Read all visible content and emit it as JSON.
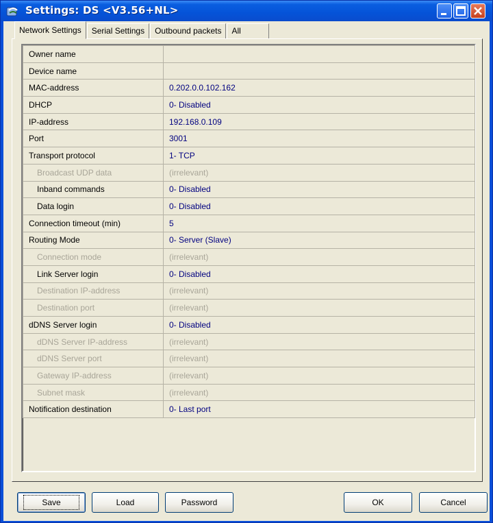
{
  "window": {
    "title": "Settings: DS <V3.56+NL>"
  },
  "tabs": [
    {
      "label": "Network Settings",
      "active": true
    },
    {
      "label": "Serial Settings",
      "active": false
    },
    {
      "label": "Outbound packets",
      "active": false
    },
    {
      "label": "All",
      "active": false
    }
  ],
  "settings": [
    {
      "name": "Owner name",
      "value": "",
      "indent": false,
      "muted": false
    },
    {
      "name": "Device name",
      "value": "",
      "indent": false,
      "muted": false
    },
    {
      "name": "MAC-address",
      "value": "0.202.0.0.102.162",
      "indent": false,
      "muted": false
    },
    {
      "name": "DHCP",
      "value": "0- Disabled",
      "indent": false,
      "muted": false
    },
    {
      "name": "IP-address",
      "value": "192.168.0.109",
      "indent": false,
      "muted": false
    },
    {
      "name": "Port",
      "value": "3001",
      "indent": false,
      "muted": false
    },
    {
      "name": "Transport protocol",
      "value": "1- TCP",
      "indent": false,
      "muted": false
    },
    {
      "name": "Broadcast UDP data",
      "value": "(irrelevant)",
      "indent": true,
      "muted": true
    },
    {
      "name": "Inband commands",
      "value": "0- Disabled",
      "indent": true,
      "muted": false
    },
    {
      "name": "Data login",
      "value": "0- Disabled",
      "indent": true,
      "muted": false
    },
    {
      "name": "Connection timeout (min)",
      "value": "5",
      "indent": false,
      "muted": false
    },
    {
      "name": "Routing Mode",
      "value": "0- Server (Slave)",
      "indent": false,
      "muted": false
    },
    {
      "name": "Connection mode",
      "value": "(irrelevant)",
      "indent": true,
      "muted": true
    },
    {
      "name": "Link Server login",
      "value": "0- Disabled",
      "indent": true,
      "muted": false
    },
    {
      "name": "Destination IP-address",
      "value": "(irrelevant)",
      "indent": true,
      "muted": true
    },
    {
      "name": "Destination port",
      "value": "(irrelevant)",
      "indent": true,
      "muted": true
    },
    {
      "name": "dDNS Server login",
      "value": "0- Disabled",
      "indent": false,
      "muted": false
    },
    {
      "name": "dDNS Server IP-address",
      "value": "(irrelevant)",
      "indent": true,
      "muted": true
    },
    {
      "name": "dDNS Server port",
      "value": "(irrelevant)",
      "indent": true,
      "muted": true
    },
    {
      "name": "Gateway IP-address",
      "value": "(irrelevant)",
      "indent": true,
      "muted": true
    },
    {
      "name": "Subnet mask",
      "value": "(irrelevant)",
      "indent": true,
      "muted": true
    },
    {
      "name": "Notification destination",
      "value": "0- Last port",
      "indent": false,
      "muted": false
    }
  ],
  "buttons": {
    "save": "Save",
    "load": "Load",
    "password": "Password",
    "ok": "OK",
    "cancel": "Cancel"
  },
  "colors": {
    "titlebar": "#0553d8",
    "value_text": "#000080",
    "muted_text": "#a8a598",
    "dialog_face": "#ece9d8"
  }
}
